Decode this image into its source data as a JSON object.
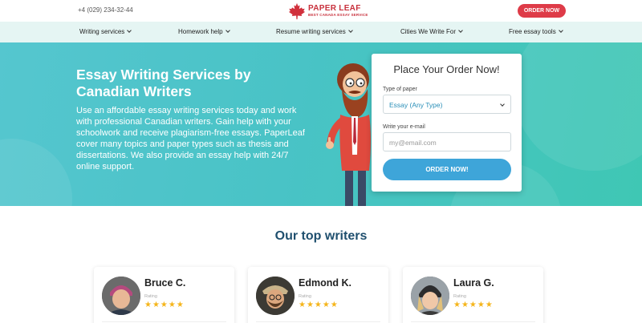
{
  "header": {
    "phone": "+4 (029) 234-32-44",
    "logo_name": "PAPER LEAF",
    "logo_tagline": "BEST CANADA ESSAY SERVICE",
    "order_button": "ORDER NOW"
  },
  "nav": {
    "items": [
      {
        "label": "Writing services"
      },
      {
        "label": "Homework help"
      },
      {
        "label": "Resume writing services"
      },
      {
        "label": "Cities We Write For"
      },
      {
        "label": "Free essay tools"
      }
    ]
  },
  "hero": {
    "title": "Essay Writing Services by Canadian Writers",
    "text": "Use an affordable essay writing services today and work with professional Canadian writers. Gain help with your schoolwork and receive plagiarism-free essays. PaperLeaf cover many topics and paper types such as thesis and dissertations. We also provide an essay help with 24/7 online support."
  },
  "order_form": {
    "title": "Place Your Order Now!",
    "paper_label": "Type of paper",
    "paper_value": "Essay (Any Type)",
    "email_label": "Write your e-mail",
    "email_placeholder": "my@email.com",
    "submit_label": "ORDER NOW!"
  },
  "writers": {
    "title": "Our top writers",
    "items": [
      {
        "name": "Bruce C.",
        "rating_label": "Rating",
        "stars": "★★★★★"
      },
      {
        "name": "Edmond K.",
        "rating_label": "Rating",
        "stars": "★★★★★"
      },
      {
        "name": "Laura G.",
        "rating_label": "Rating",
        "stars": "★★★★★"
      }
    ]
  },
  "colors": {
    "brand_red": "#de3b48",
    "hero_teal": "#49c3c6",
    "button_blue": "#3ea5d9",
    "heading_navy": "#1f4f6e",
    "star_gold": "#f5b51b"
  }
}
